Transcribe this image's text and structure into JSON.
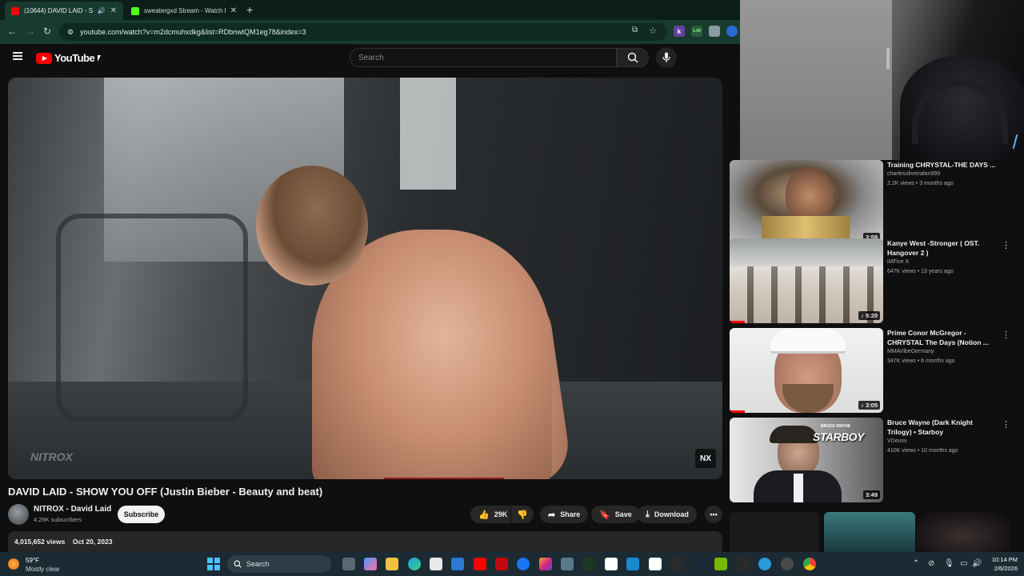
{
  "browser": {
    "tabs": [
      {
        "title": "(10644) DAVID LAID - SHOW",
        "active": true,
        "favicon_color": "#ff0000"
      },
      {
        "title": "sweatergxd Stream - Watch Liv",
        "active": false,
        "favicon_color": "#53fc18"
      }
    ],
    "url": "youtube.com/watch?v=m2dcmuhxdkg&list=RDbnwtQM1eg78&index=3",
    "extensions": [
      "k",
      "1.00",
      "",
      ""
    ]
  },
  "youtube": {
    "logo_text": "YouTube",
    "search_placeholder": "Search"
  },
  "video": {
    "title": "DAVID LAID - SHOW YOU OFF (Justin Bieber - Beauty and beat)",
    "watermark_left": "NITROX",
    "watermark_right": "NX",
    "channel": {
      "name": "NITROX - David Laid",
      "subscribers": "4.25K subscribers"
    },
    "subscribe_label": "Subscribe",
    "likes": "29K",
    "share_label": "Share",
    "save_label": "Save",
    "download_label": "Download",
    "views": "4,015,652 views",
    "date": "Oct 20, 2023"
  },
  "recommendations": [
    {
      "title": "Training CHRYSTAL-THE DAYS ...",
      "channel": "charlesoliveirafan999",
      "meta": "2.2K views • 3 months ago",
      "duration": "3:59",
      "progress": 1.0
    },
    {
      "title": "Kanye West -Stronger ( OST. Hangover 2 )",
      "channel": "iMFive X",
      "meta": "647K views • 13 years ago",
      "duration": "5:20",
      "progress": 0.1
    },
    {
      "title": "Prime Conor McGregor - CHRYSTAL The Days (Notion ...",
      "channel": "MMAVibeGermany",
      "meta": "347K views • 6 months ago",
      "duration": "3:05",
      "progress": 0.1
    },
    {
      "title": "Bruce Wayne (Dark Knight Trilogy) • Starboy",
      "channel": "VDeuxx",
      "meta": "410K views • 10 months ago",
      "duration": "3:49",
      "progress": 0.0,
      "thumb_text": "STARBOY",
      "thumb_subtext": "BRUCE WAYNE"
    }
  ],
  "taskbar": {
    "weather_temp": "59°F",
    "weather_cond": "Mostly clear",
    "search_label": "Search",
    "time": "10:14 PM",
    "date": "2/6/2026"
  }
}
